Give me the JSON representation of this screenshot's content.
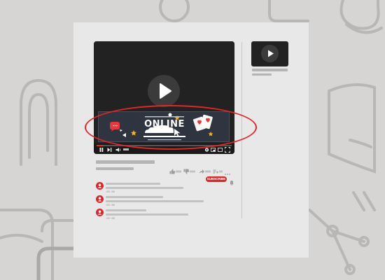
{
  "banner": {
    "title": "ONLINE"
  },
  "player": {
    "progress_fraction": 0.05
  },
  "channel": {
    "subscribe_label": "SUBSCRIBE"
  },
  "comments": [
    {
      "meta": "◦20 ◦30"
    },
    {
      "meta": "◦20 ◦30"
    },
    {
      "meta": "◦20 ◦30"
    }
  ],
  "colors": {
    "background": "#d6d5d3",
    "panel": "#e8e8e8",
    "player": "#222222",
    "accent_red": "#d9252b",
    "highlight_ring": "#e1262b"
  },
  "icons": [
    "play-icon",
    "pause-icon",
    "next-icon",
    "volume-icon",
    "settings-icon",
    "fullscreen-icon",
    "like-icon",
    "dislike-icon",
    "share-icon",
    "more-icon",
    "bell-icon",
    "user-icon"
  ]
}
